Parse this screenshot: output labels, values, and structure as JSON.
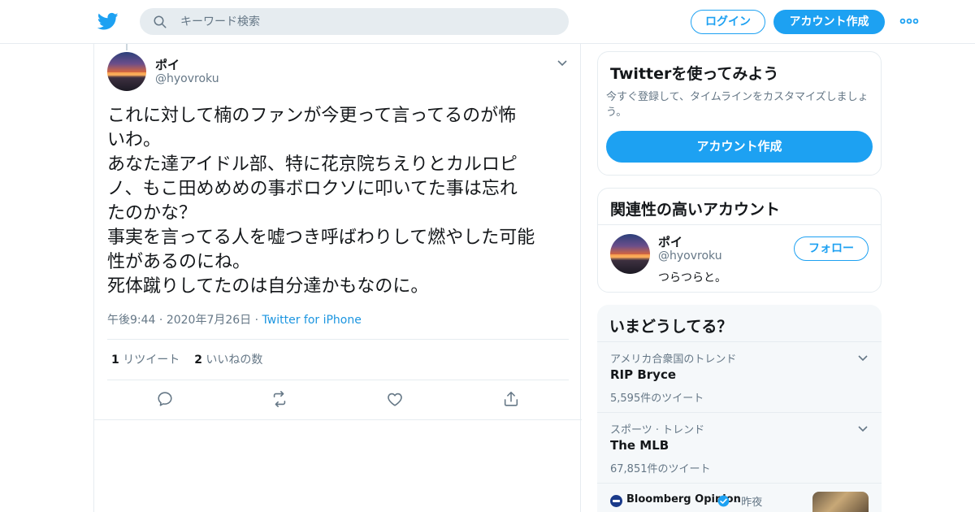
{
  "header": {
    "search_placeholder": "キーワード検索",
    "login_label": "ログイン",
    "signup_label": "アカウント作成"
  },
  "tweet": {
    "name": "ポイ",
    "handle": "@hyovroku",
    "text": "これに対して楠のファンが今更って言ってるのが怖\nいわ。\nあなた達アイドル部、特に花京院ちえりとカルロピ\nノ、もこ田めめめの事ボロクソに叩いてた事は忘れ\nたのかな？\n事実を言ってる人を嘘つき呼ばわりして燃やした可能\n性があるのにね。\n死体蹴りしてたのは自分達かもなのに。",
    "time": "午後9:44",
    "date": "2020年7月26日",
    "source": "Twitter for iPhone",
    "retweet_count": "1",
    "retweet_label": "リツイート",
    "like_count": "2",
    "like_label": "いいねの数"
  },
  "sidebar": {
    "try_twitter": {
      "title": "Twitterを使ってみよう",
      "subtitle": "今すぐ登録して、タイムラインをカスタマイズしましょう。",
      "button": "アカウント作成"
    },
    "related": {
      "title": "関連性の高いアカウント",
      "name": "ポイ",
      "handle": "@hyovroku",
      "bio": "つらつらと。",
      "follow": "フォロー"
    },
    "trends": {
      "title": "いまどうしてる？",
      "items": [
        {
          "context": "アメリカ合衆国のトレンド",
          "name": "RIP Bryce",
          "count": "5,595件のツイート"
        },
        {
          "context": "スポーツ · トレンド",
          "name": "The MLB",
          "count": "67,851件のツイート"
        }
      ],
      "news": {
        "source": "Bloomberg Opinion",
        "time": "昨夜"
      }
    }
  },
  "colors": {
    "accent": "#1da1f2",
    "text": "#14171a",
    "secondary": "#657786",
    "border": "#e6ecf0",
    "sidebar_bg": "#f5f8fa"
  },
  "icons": [
    "twitter-logo-icon",
    "search-icon",
    "more-icon",
    "chevron-down-icon",
    "reply-icon",
    "retweet-icon",
    "like-icon",
    "share-icon",
    "verified-icon"
  ]
}
